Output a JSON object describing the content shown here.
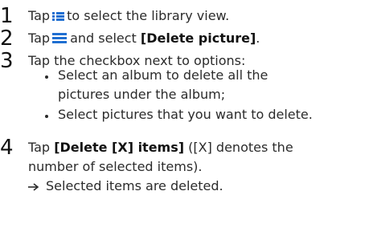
{
  "steps": [
    {
      "number": "1",
      "pre": "Tap",
      "icon": "library-view-icon",
      "post": "to select the library view."
    },
    {
      "number": "2",
      "pre": "Tap",
      "icon": "menu-icon",
      "post": "and select",
      "emphasis": "[Delete picture]",
      "end": "."
    },
    {
      "number": "3",
      "text": "Tap the checkbox next to options:",
      "bullets": [
        {
          "line1": "Select an album to delete all the",
          "line2": "pictures under the album;"
        },
        {
          "line1": "Select pictures that you want to delete."
        }
      ]
    },
    {
      "number": "4",
      "pre": "Tap",
      "emphasis": "[Delete [X] items]",
      "post": "([X] denotes the",
      "line2": "number of selected items).",
      "result_icon": "result-arrow-icon",
      "result": "Selected items are deleted."
    }
  ],
  "colors": {
    "icon_blue": "#1f6fd1",
    "text": "#2b2b2b"
  }
}
